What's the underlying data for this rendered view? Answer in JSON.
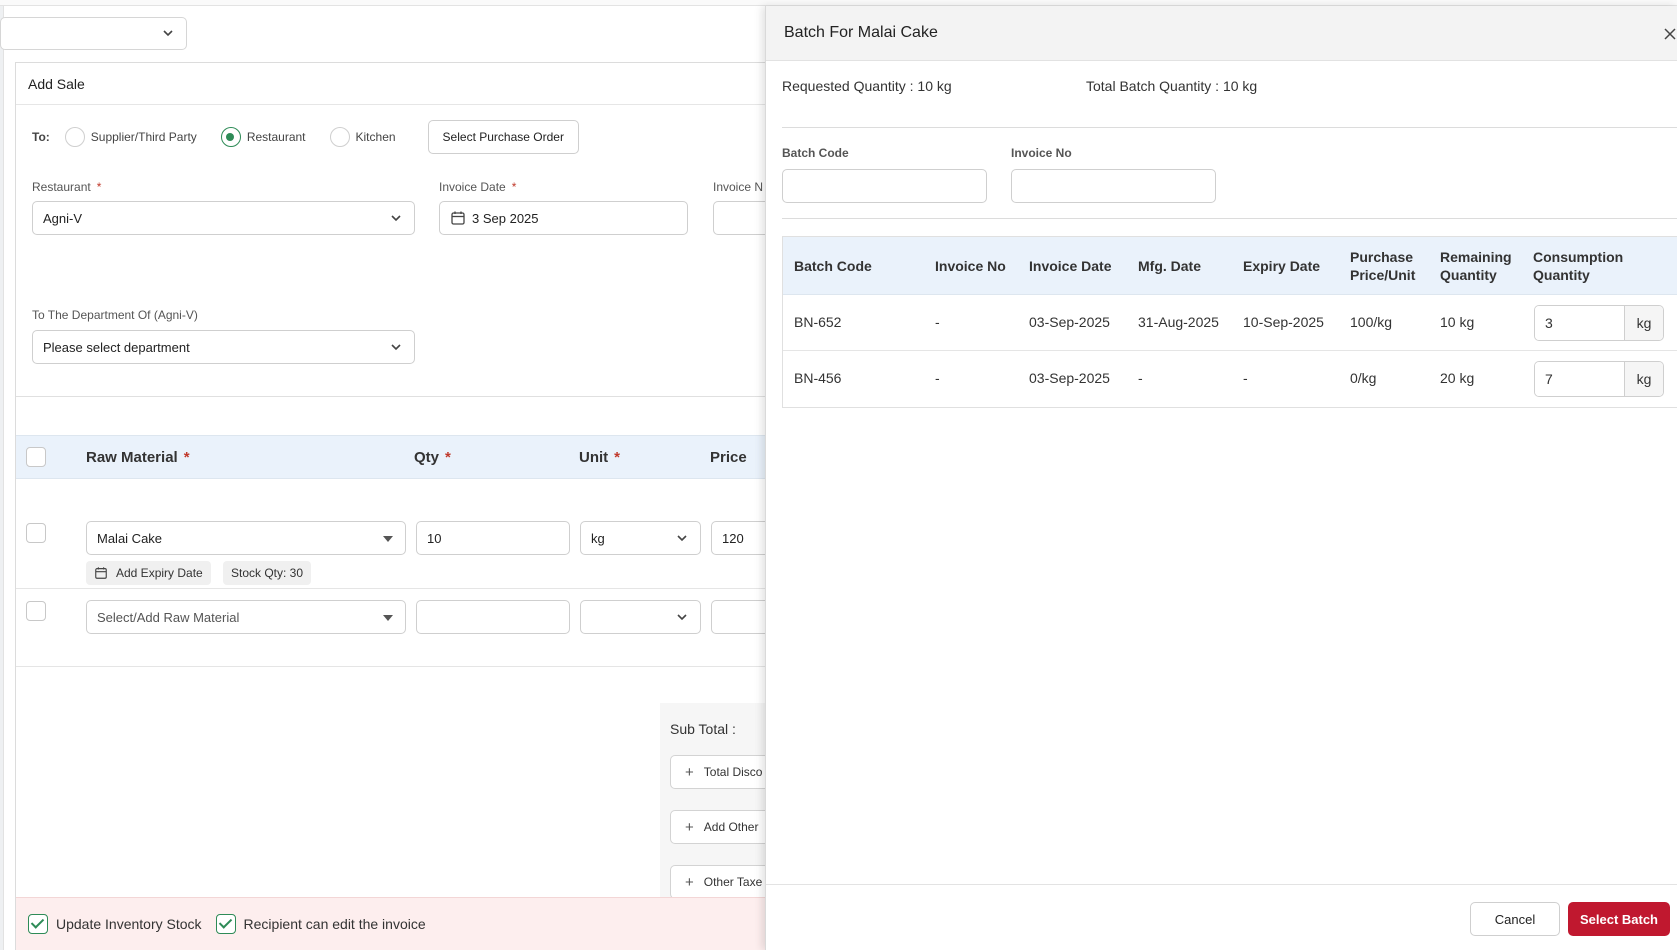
{
  "app": {
    "accent_color": "#c0182f",
    "radio_color": "#2e8b57",
    "header_row_color": "#eaf2fb"
  },
  "sale_form": {
    "title": "Add Sale",
    "to_label": "To:",
    "recipient_options": [
      {
        "label": "Supplier/Third Party",
        "selected": false
      },
      {
        "label": "Restaurant",
        "selected": true
      },
      {
        "label": "Kitchen",
        "selected": false
      }
    ],
    "select_po_label": "Select Purchase Order",
    "restaurant": {
      "label": "Restaurant",
      "value": "Agni-V"
    },
    "invoice_date": {
      "label": "Invoice Date",
      "value": "3 Sep 2025"
    },
    "invoice_no_label": "Invoice N",
    "department": {
      "label": "To The Department Of (Agni-V)",
      "placeholder": "Please select department"
    },
    "items_table": {
      "headers": {
        "raw_material": "Raw Material",
        "qty": "Qty",
        "unit": "Unit",
        "price": "Price"
      },
      "rows": [
        {
          "raw_material": "Malai Cake",
          "qty": "10",
          "unit": "kg",
          "price": "120",
          "expiry_label": "Add Expiry Date",
          "stock_label": "Stock Qty: 30"
        },
        {
          "raw_material": "Select/Add Raw Material",
          "qty": "",
          "unit": "",
          "price": ""
        }
      ]
    },
    "summary": {
      "subtotal_label": "Sub Total :",
      "total_discount_label": "Total Disco",
      "add_other_label": "Add Other",
      "other_taxes_label": "Other Taxe"
    },
    "footer": {
      "update_inventory_label": "Update Inventory Stock",
      "recipient_edit_label": "Recipient can edit the invoice"
    }
  },
  "drawer": {
    "title": "Batch For Malai Cake",
    "requested_qty": "Requested Quantity : 10 kg",
    "total_batch_qty": "Total Batch Quantity : 10 kg",
    "filters": {
      "batch_code_label": "Batch Code",
      "invoice_no_label": "Invoice No"
    },
    "table": {
      "headers": {
        "batch_code": "Batch Code",
        "invoice_no": "Invoice No",
        "invoice_date": "Invoice Date",
        "mfg_date": "Mfg. Date",
        "expiry_date": "Expiry Date",
        "purchase_price_1": "Purchase",
        "purchase_price_2": "Price/Unit",
        "remaining_qty_1": "Remaining",
        "remaining_qty_2": "Quantity",
        "consumption_qty_1": "Consumption",
        "consumption_qty_2": "Quantity"
      },
      "rows": [
        {
          "batch_code": "BN-652",
          "invoice_no": "-",
          "invoice_date": "03-Sep-2025",
          "mfg_date": "31-Aug-2025",
          "expiry_date": "10-Sep-2025",
          "price": "100/kg",
          "remaining": "10 kg",
          "consumption": "3",
          "unit": "kg"
        },
        {
          "batch_code": "BN-456",
          "invoice_no": "-",
          "invoice_date": "03-Sep-2025",
          "mfg_date": "-",
          "expiry_date": "-",
          "price": "0/kg",
          "remaining": "20 kg",
          "consumption": "7",
          "unit": "kg"
        }
      ]
    },
    "cancel_label": "Cancel",
    "select_label": "Select Batch"
  }
}
